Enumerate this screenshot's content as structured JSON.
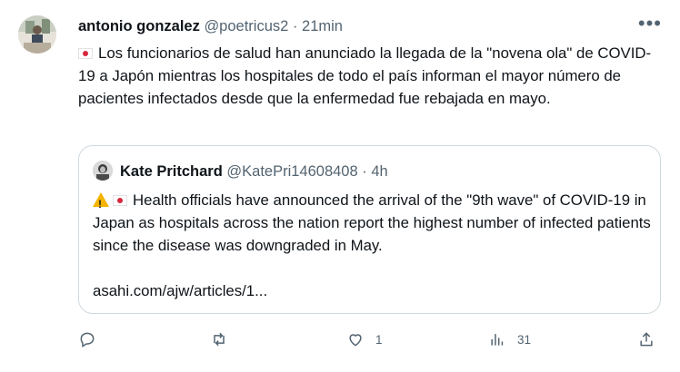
{
  "tweet": {
    "author_name": "antonio gonzalez",
    "author_handle": "@poetricus2",
    "separator": "·",
    "time": "21min",
    "more_icon": "more-horizontal-icon",
    "text": "Los funcionarios de salud han anunciado la llegada de la \"novena ola\" de COVID-19 a Japón mientras los hospitales de todo el país informan el mayor número de pacientes infectados desde que la enfermedad fue rebajada en mayo.",
    "flag_icon": "japan-flag-icon"
  },
  "quote": {
    "author_name": "Kate Pritchard",
    "author_handle": "@KatePri14608408",
    "separator": "·",
    "time": "4h",
    "text": "Health officials have announced the arrival of the \"9th wave\" of COVID-19 in Japan as hospitals across the nation report the highest number of infected patients since the disease was downgraded in May.",
    "link": "asahi.com/ajw/articles/1...",
    "icons": [
      "warning-icon",
      "japan-flag-icon"
    ]
  },
  "actions": {
    "reply": {
      "icon": "reply-icon",
      "count": ""
    },
    "retweet": {
      "icon": "retweet-icon",
      "count": ""
    },
    "like": {
      "icon": "heart-icon",
      "count": "1"
    },
    "views": {
      "icon": "views-icon",
      "count": "31"
    },
    "share": {
      "icon": "share-icon",
      "count": ""
    }
  },
  "colors": {
    "text": "#0f1419",
    "muted": "#536471",
    "border": "#cfd9de",
    "flag_red": "#d7263d",
    "warning": "#f4b400"
  }
}
